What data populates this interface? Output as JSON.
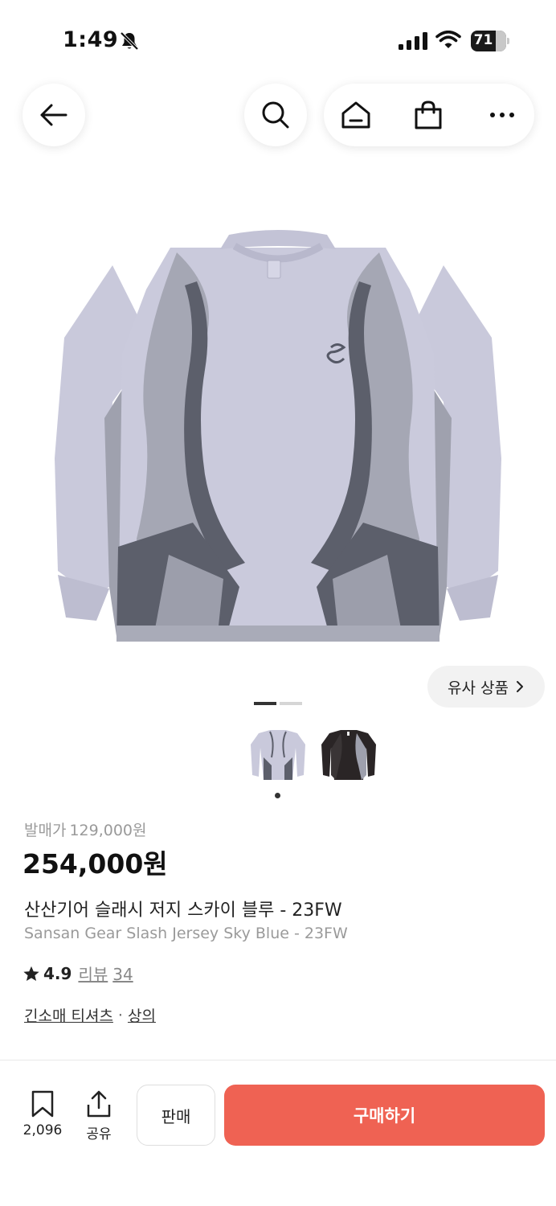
{
  "status_bar": {
    "time": "1:49",
    "battery": "71"
  },
  "nav": {
    "back_icon": "arrow-left-icon",
    "search_icon": "search-icon",
    "home_icon": "home-icon",
    "bag_icon": "shopping-bag-icon",
    "more_icon": "more-horizontal-icon"
  },
  "product_image": {
    "selected_index": 0,
    "total": 2
  },
  "similar_products": {
    "label": "유사 상품"
  },
  "thumbnails": [
    {
      "name": "thumbnail-sky-blue"
    },
    {
      "name": "thumbnail-black"
    }
  ],
  "pricing": {
    "original_label": "발매가",
    "original_price": "129,000원",
    "current_price": "254,000원"
  },
  "product": {
    "title_ko": "산산기어 슬래시 저지 스카이 블루 - 23FW",
    "title_en": "Sansan Gear Slash Jersey Sky Blue - 23FW"
  },
  "rating": {
    "score": "4.9",
    "reviews_label": "리뷰",
    "reviews_count": "34"
  },
  "categories": [
    "긴소매 티셔츠",
    "상의"
  ],
  "category_separator": "·",
  "bottom_bar": {
    "bookmark_count": "2,096",
    "share_label": "공유",
    "sell_label": "판매",
    "buy_label": "구매하기"
  },
  "colors": {
    "accent": "#ef6253",
    "jersey_main": "#c9c9dc",
    "jersey_panel": "#9ea0ae",
    "jersey_dark": "#5a5d68"
  }
}
